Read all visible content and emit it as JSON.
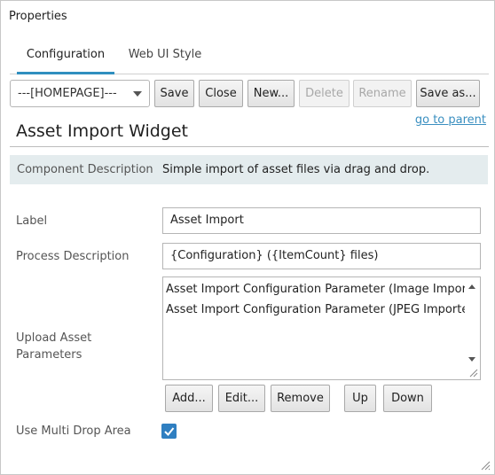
{
  "window": {
    "title": "Properties"
  },
  "tabs": [
    {
      "label": "Configuration"
    },
    {
      "label": "Web UI Style"
    }
  ],
  "toolbar": {
    "select_value": "---[HOMEPAGE]---",
    "save_label": "Save",
    "close_label": "Close",
    "new_label": "New...",
    "delete_label": "Delete",
    "rename_label": "Rename",
    "save_as_label": "Save as..."
  },
  "nav": {
    "go_to_parent": "go to parent"
  },
  "main": {
    "heading": "Asset Import Widget",
    "component_description_label": "Component Description",
    "component_description_value": "Simple import of asset files via drag and drop.",
    "label_label": "Label",
    "label_value": "Asset Import",
    "process_description_label": "Process Description",
    "process_description_value": "{Configuration} ({ItemCount} files)",
    "upload_params_label": "Upload Asset Parameters",
    "upload_params_items": [
      "Asset Import Configuration Parameter (Image Importer",
      "Asset Import Configuration Parameter (JPEG Importer /"
    ],
    "list_buttons": {
      "add": "Add...",
      "edit": "Edit...",
      "remove": "Remove",
      "up": "Up",
      "down": "Down"
    },
    "multi_drop_label": "Use Multi Drop Area",
    "multi_drop_checked": true
  },
  "colors": {
    "accent": "#2f8fbf",
    "checkbox": "#2f7fc1",
    "link": "#3a8fc0",
    "description_bg": "#e4ecee"
  }
}
